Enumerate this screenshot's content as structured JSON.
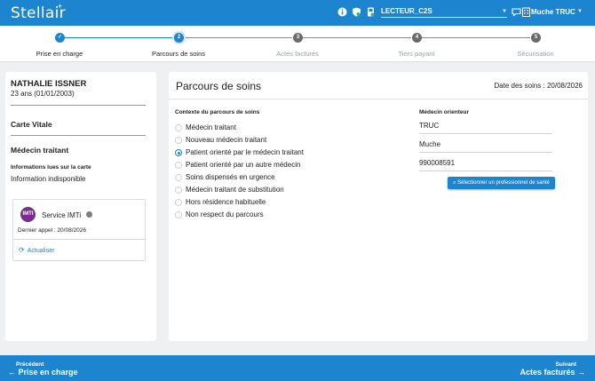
{
  "header": {
    "logo": "Stellair",
    "logo_plus": "+",
    "reader": "LECTEUR_C2S",
    "user": "Muche TRUC",
    "icons": [
      "info-icon",
      "shield-icon",
      "card-reader-icon",
      "chat-icon",
      "building-icon"
    ]
  },
  "stepper": {
    "steps": [
      {
        "number": "✓",
        "label": "Prise en charge",
        "state": "done"
      },
      {
        "number": "2",
        "label": "Parcours de soins",
        "state": "active"
      },
      {
        "number": "3",
        "label": "Actes facturés",
        "state": "todo"
      },
      {
        "number": "4",
        "label": "Tiers payant",
        "state": "todo"
      },
      {
        "number": "5",
        "label": "Sécurisation",
        "state": "todo"
      }
    ]
  },
  "patient": {
    "name": "NATHALIE ISSNER",
    "age": "23 ans (01/01/2003)",
    "carte_vitale": "Carte Vitale",
    "medecin_traitant": "Médecin traitant",
    "info_title": "Informations lues sur la carte",
    "info_value": "Information indisponible"
  },
  "imti": {
    "logo": "IMTI",
    "name": "Service IMTi",
    "last_call": "Dernier appel : 20/08/2026",
    "refresh": "Actualiser"
  },
  "main": {
    "title": "Parcours de soins",
    "date": "Date des soins : 20/08/2026",
    "context_title": "Contexte du parcours de soins",
    "options": [
      {
        "label": "Médecin traitant",
        "checked": false
      },
      {
        "label": "Nouveau médecin traitant",
        "checked": false
      },
      {
        "label": "Patient orienté par le médecin traitant",
        "checked": true
      },
      {
        "label": "Patient orienté par un autre médecin",
        "checked": false
      },
      {
        "label": "Soins dispensés en urgence",
        "checked": false
      },
      {
        "label": "Médecin traitant de substitution",
        "checked": false
      },
      {
        "label": "Hors résidence habituelle",
        "checked": false
      },
      {
        "label": "Non respect du parcours",
        "checked": false
      }
    ],
    "orienteur_title": "Médecin orienteur",
    "orienteur_last_name": "TRUC",
    "orienteur_first_name": "Muche",
    "orienteur_id": "990008591",
    "select_button": "Sélectionner un professionnel de santé"
  },
  "footer": {
    "prev_small": "Précédent",
    "prev_big": "Prise en charge",
    "next_small": "Suivant",
    "next_big": "Actes facturés"
  },
  "colors": {
    "accent": "#1d84d0",
    "imti": "#7b2d8e"
  }
}
